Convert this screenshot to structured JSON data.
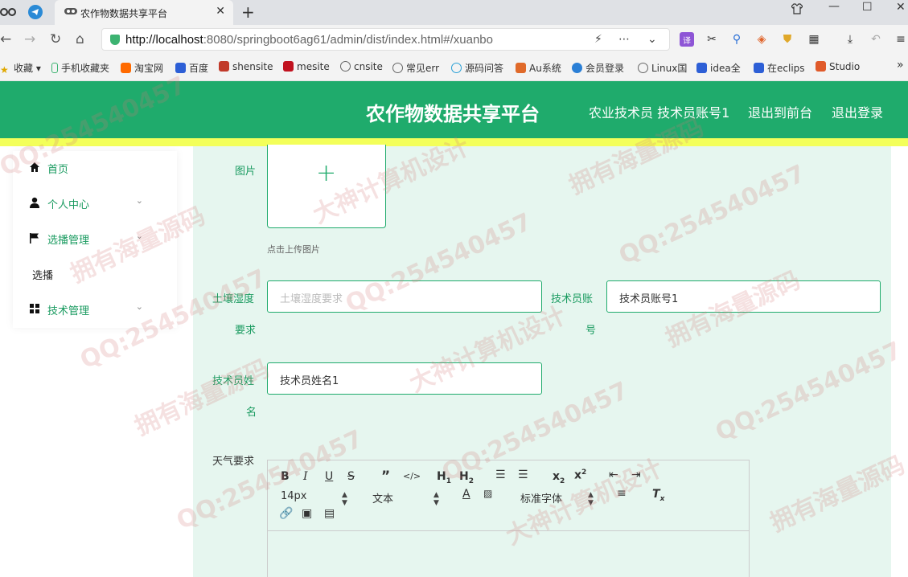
{
  "browser": {
    "tab_title": "农作物数据共享平台",
    "url_host": "http://localhost",
    "url_rest": ":8080/springboot6ag61/admin/dist/index.html#/xuanbo",
    "bookmarks": [
      "收藏",
      "手机收藏夹",
      "淘宝网",
      "百度",
      "shensite",
      "mesite",
      "cnsite",
      "常见err",
      "源码问答",
      "Au系统",
      "会员登录",
      "Linux国",
      "idea全",
      "在eclips",
      "Studio"
    ]
  },
  "header": {
    "title": "农作物数据共享平台",
    "user": "农业技术员 技术员账号1",
    "to_front": "退出到前台",
    "logout": "退出登录"
  },
  "sidebar": {
    "items": [
      {
        "label": "首页"
      },
      {
        "label": "个人中心"
      },
      {
        "label": "选播管理"
      },
      {
        "label": "技术管理"
      }
    ],
    "sub_item": "选播"
  },
  "form": {
    "image_label": "图片",
    "upload_hint": "点击上传图片",
    "soil_label_1": "土壤湿度",
    "soil_label_2": "要求",
    "soil_placeholder": "土壤湿度要求",
    "tech_account_label_1": "技术员账",
    "tech_account_label_2": "号",
    "tech_account_value": "技术员账号1",
    "tech_name_label_1": "技术员姓",
    "tech_name_label_2": "名",
    "tech_name_value": "技术员姓名1",
    "weather_label": "天气要求"
  },
  "editor": {
    "font_size": "14px",
    "text_type": "文本",
    "font_family": "标准字体"
  },
  "watermarks": [
    "QQ:254540457",
    "拥有海量源码",
    "大神计算机设计"
  ],
  "colors": {
    "header_green": "#1fab6c",
    "main_bg": "#e6f6ef",
    "accent_yellow": "#f3ff5a"
  }
}
